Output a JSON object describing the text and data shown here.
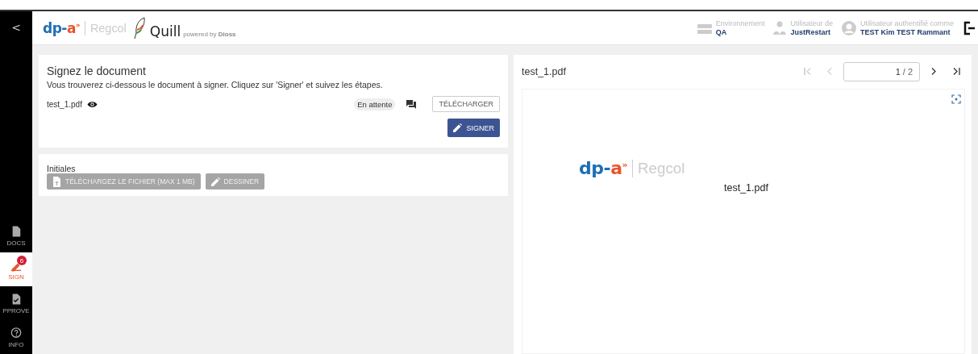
{
  "sidebar": {
    "collapse_label": "<",
    "items": [
      {
        "label": "DOCS",
        "kind": "docs",
        "selected": false
      },
      {
        "label": "SIGN",
        "kind": "sign",
        "selected": true,
        "badge": "6"
      },
      {
        "label": "PPROVE",
        "kind": "approve",
        "selected": false
      },
      {
        "label": "INFO",
        "kind": "info",
        "selected": false
      }
    ]
  },
  "header": {
    "logo": {
      "brand_start": "dp-",
      "brand_end": "a",
      "mark": "»",
      "product": "Regcol",
      "app": "Quill",
      "powered_by": "powered by **Dioss**"
    },
    "info": [
      {
        "kind": "environment",
        "label": "Environnement",
        "value": "QA"
      },
      {
        "kind": "organisation",
        "label": "Utilisateur de",
        "value": "JustRestart"
      },
      {
        "kind": "user",
        "label": "Utilisateur authentifié comme",
        "value": "TEST Kim TEST Rammant"
      }
    ]
  },
  "sign_card": {
    "title": "Signez le document",
    "instructions": "Vous trouverez ci-dessous le document à signer. Cliquez sur 'Signer' et suivez les étapes.",
    "file": "test_1.pdf",
    "status": "En attente",
    "download_button": "TÉLÉCHARGER",
    "sign_button": "SIGNER"
  },
  "initials_card": {
    "title": "Initiales",
    "buttons": [
      {
        "kind": "upload",
        "label": "TÉLÉCHARGEZ LE FICHIER (MAX 1 MB)",
        "disabled": true
      },
      {
        "kind": "draw",
        "label": "DESSINER",
        "disabled": true
      }
    ]
  },
  "viewer": {
    "file_name": "test_1.pdf",
    "page": "1",
    "page_count": "/ 2",
    "document": {
      "brand_start": "dp-",
      "brand_end": "a",
      "mark": "»",
      "product": "Regcol",
      "file_name": "test_1.pdf"
    }
  }
}
